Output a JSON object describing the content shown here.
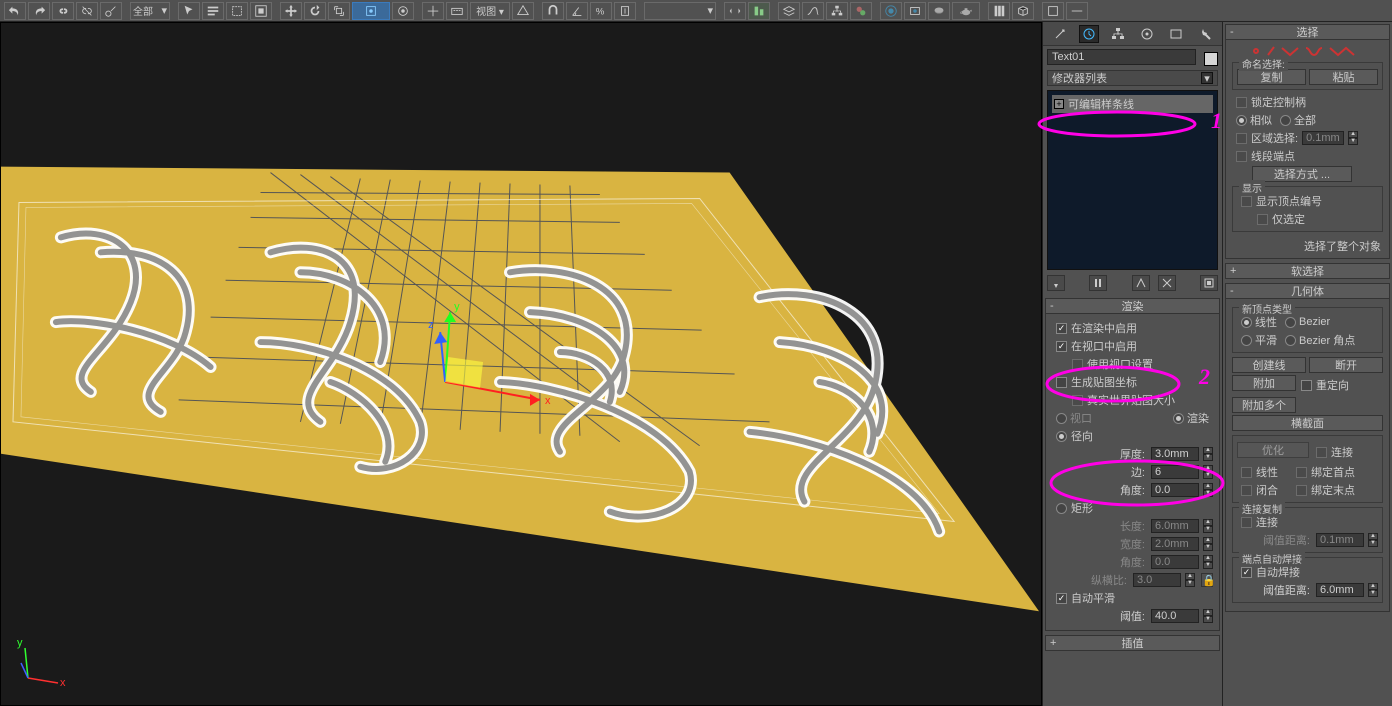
{
  "obj_name": "Text01",
  "modifier_list_label": "修改器列表",
  "mod_stack_item": "可编辑样条线",
  "rollout_render": {
    "title": "渲染",
    "enable_render": "在渲染中启用",
    "enable_viewport": "在视口中启用",
    "use_vp_settings": "使用视口设置",
    "gen_map_coords": "生成贴图坐标",
    "real_world_map": "真实世界贴图大小",
    "mode_view": "视口",
    "mode_render": "渲染",
    "radial": "径向",
    "thickness_lbl": "厚度:",
    "thickness_val": "3.0mm",
    "sides_lbl": "边:",
    "sides_val": "6",
    "angle_lbl": "角度:",
    "angle_val": "0.0",
    "rect": "矩形",
    "length_lbl": "长度:",
    "length_val": "6.0mm",
    "width_lbl": "宽度:",
    "width_val": "2.0mm",
    "angle2_lbl": "角度:",
    "angle2_val": "0.0",
    "aspect_lbl": "纵横比:",
    "aspect_val": "3.0",
    "auto_smooth": "自动平滑",
    "threshold_lbl": "阈值:",
    "threshold_val": "40.0"
  },
  "rollout_interp_title": "插值",
  "ext_panel": {
    "selection_title": "选择",
    "named_sel": "命名选择:",
    "copy": "复制",
    "paste": "粘贴",
    "lock_handles": "锁定控制柄",
    "similar": "相似",
    "all": "全部",
    "area_select": "区域选择:",
    "area_val": "0.1mm",
    "seg_end": "线段端点",
    "select_by": "选择方式 ...",
    "display": "显示",
    "show_vert_num": "显示顶点编号",
    "only_selected": "仅选定",
    "selected_whole": "选择了整个对象",
    "soft_sel_title": "软选择",
    "geometry_title": "几何体",
    "new_vert_type": "新顶点类型",
    "linear": "线性",
    "bezier": "Bezier",
    "smooth": "平滑",
    "bezier_corner": "Bezier 角点",
    "create_line": "创建线",
    "break": "断开",
    "attach": "附加",
    "reorient": "重定向",
    "attach_mult": "附加多个",
    "xsection": "横截面",
    "optimize": "优化",
    "connect1": "连接",
    "linear2": "线性",
    "bind_first": "绑定首点",
    "close": "闭合",
    "bind_last": "绑定末点",
    "conn_copy": "连接复制",
    "connect2": "连接",
    "thresh_dist": "阈值距离:",
    "thresh_val": "0.1mm",
    "end_auto_weld": "端点自动焊接",
    "auto_weld": "自动焊接",
    "thresh_dist2": "阈值距离:",
    "thresh_val2": "6.0mm"
  }
}
